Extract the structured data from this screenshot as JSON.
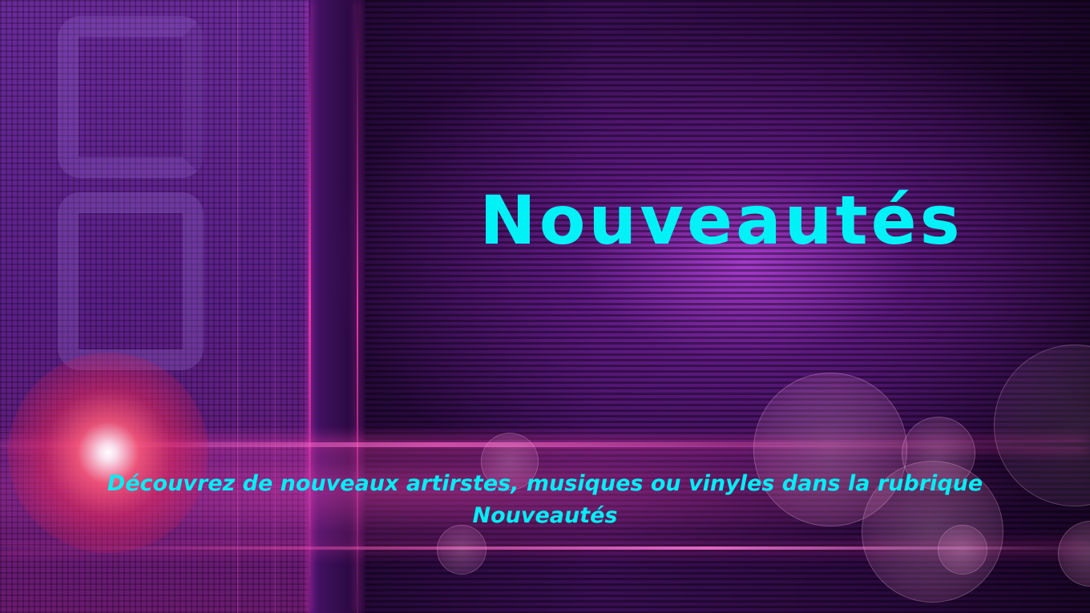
{
  "heading": {
    "title": "Nouveautés"
  },
  "description": {
    "line1": "Découvrez de nouveaux artirstes, musiques ou vinyles  dans la rubrique",
    "line2": "Nouveautés"
  },
  "colors": {
    "text_accent": "#00f2f7",
    "background_primary": "#3a0f55",
    "neon_pink": "#ff3cb4"
  }
}
